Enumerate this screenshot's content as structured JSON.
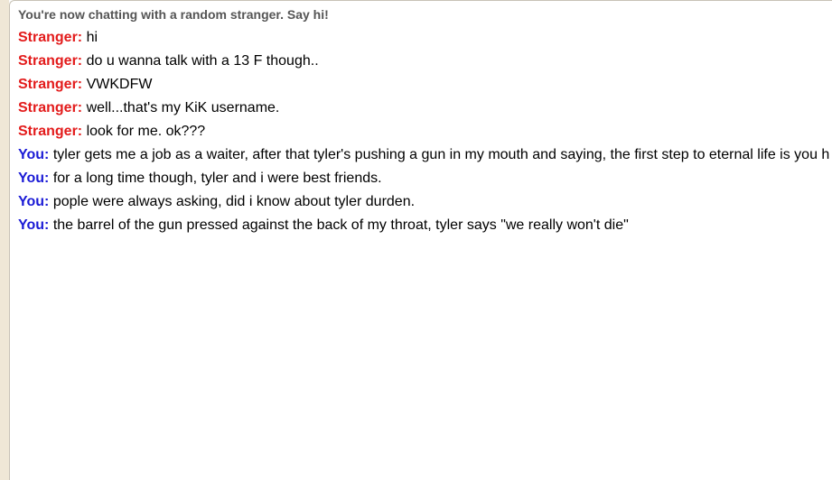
{
  "chat": {
    "status": "You're now chatting with a random stranger. Say hi!",
    "colors": {
      "stranger": "#e31b1b",
      "you": "#1a1ad6",
      "status": "#555555"
    },
    "messages": [
      {
        "speaker": "Stranger:",
        "text": "hi"
      },
      {
        "speaker": "Stranger:",
        "text": "do u wanna talk with a 13 F though.."
      },
      {
        "speaker": "Stranger:",
        "text": "VWKDFW"
      },
      {
        "speaker": "Stranger:",
        "text": "well...that's my KiK username."
      },
      {
        "speaker": "Stranger:",
        "text": "look for me. ok???"
      },
      {
        "speaker": "You:",
        "text": "tyler gets me a job as a waiter, after that tyler's pushing a gun in my mouth and saying, the first step to eternal life is you h"
      },
      {
        "speaker": "You:",
        "text": "for a long time though, tyler and i were best friends."
      },
      {
        "speaker": "You:",
        "text": "pople were always asking, did i know about tyler durden."
      },
      {
        "speaker": "You:",
        "text": "the barrel of the gun pressed against the back of my throat, tyler says \"we really won't die\""
      }
    ]
  }
}
